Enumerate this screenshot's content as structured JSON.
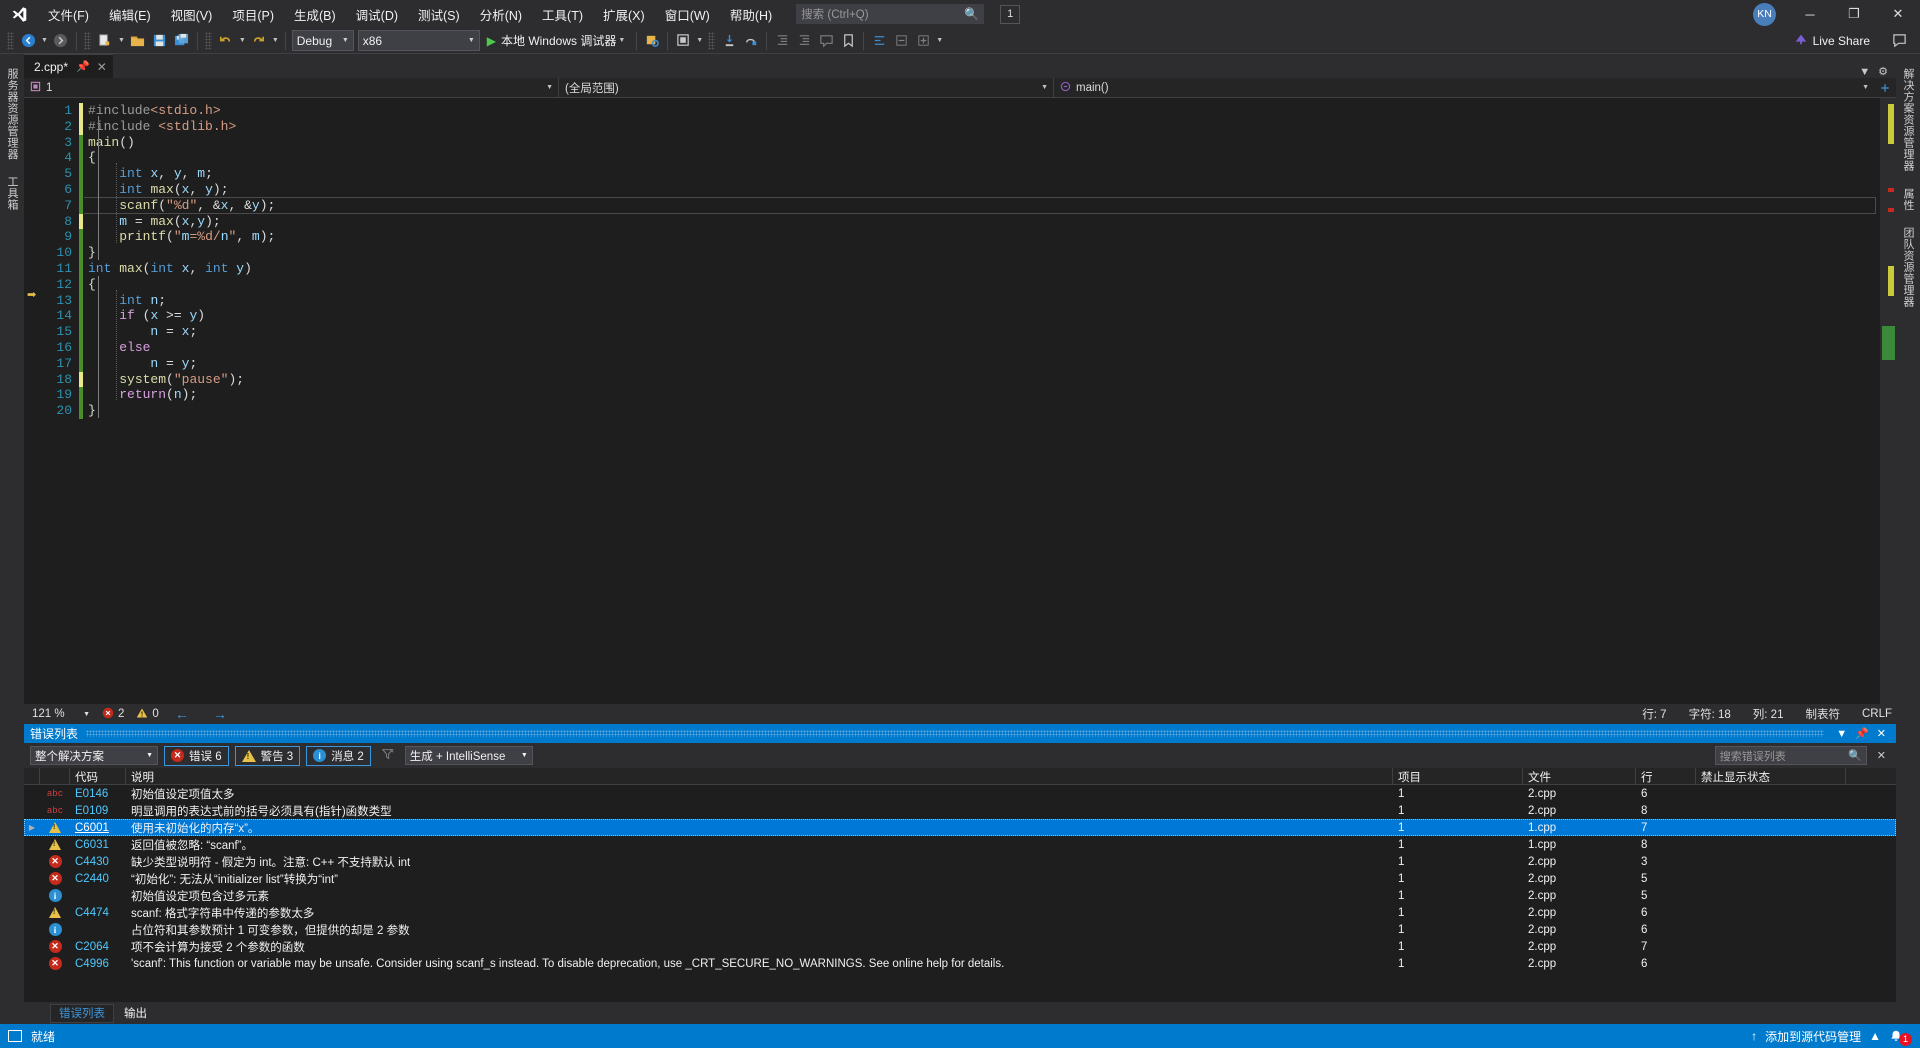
{
  "titlebar": {
    "logo_icon": "visual-studio-logo",
    "menus": [
      "文件(F)",
      "编辑(E)",
      "视图(V)",
      "项目(P)",
      "生成(B)",
      "调试(D)",
      "测试(S)",
      "分析(N)",
      "工具(T)",
      "扩展(X)",
      "窗口(W)",
      "帮助(H)"
    ],
    "search_placeholder": "搜索 (Ctrl+Q)",
    "search_icon": "search-icon",
    "notification_count": "1",
    "avatar_initials": "KN",
    "minimize_icon": "─",
    "maximize_icon": "❐",
    "close_icon": "✕"
  },
  "toolbar": {
    "back_icon": "navigate-back-icon",
    "forward_icon": "navigate-forward-icon",
    "new_item_icon": "new-item-icon",
    "open_icon": "open-file-icon",
    "save_icon": "save-icon",
    "save_all_icon": "save-all-icon",
    "undo_icon": "undo-icon",
    "redo_icon": "redo-icon",
    "config_value": "Debug",
    "platform_value": "x86",
    "run_label": "本地 Windows 调试器",
    "play_icon": "play-icon",
    "live_share_label": "Live Share",
    "live_share_icon": "live-share-icon",
    "feedback_icon": "feedback-icon"
  },
  "left_rail": {
    "tabs": [
      "服务器资源管理器",
      "工具箱"
    ]
  },
  "right_rail": {
    "tabs": [
      "解决方案资源管理器",
      "属性",
      "团队资源管理器"
    ]
  },
  "editor": {
    "tab_title": "2.cpp*",
    "pin_icon": "pin-icon",
    "close_icon": "✕",
    "nav_scope_icon": "project-icon",
    "nav_project": "1",
    "nav_scope": "(全局范围)",
    "nav_member_icon": "method-icon",
    "nav_member": "main()",
    "lines": [
      {
        "n": "1",
        "html": "#include<stdio.h>",
        "fold": "minus",
        "change": "mod"
      },
      {
        "n": "2",
        "html": "#include <stdlib.h>",
        "change": "mod"
      },
      {
        "n": "3",
        "html": "main()",
        "fold": "minus",
        "change": "save"
      },
      {
        "n": "4",
        "html": "{",
        "change": "save"
      },
      {
        "n": "5",
        "html": "    int x, y, m;",
        "change": "save"
      },
      {
        "n": "6",
        "html": "    int max(x, y);",
        "change": "save"
      },
      {
        "n": "7",
        "html": "    scanf(\"%d\", &x, &y);",
        "change": "save",
        "current": true
      },
      {
        "n": "8",
        "html": "    m = max(x,y);",
        "change": "mod"
      },
      {
        "n": "9",
        "html": "    printf(\"m=%d/n\", m);",
        "change": "save"
      },
      {
        "n": "10",
        "html": "}",
        "change": "save"
      },
      {
        "n": "11",
        "html": "int max(int x, int y)",
        "fold": "minus",
        "change": "save"
      },
      {
        "n": "12",
        "html": "{",
        "change": "save"
      },
      {
        "n": "13",
        "html": "    int n;",
        "change": "save"
      },
      {
        "n": "14",
        "html": "    if (x >= y)",
        "change": "save"
      },
      {
        "n": "15",
        "html": "        n = x;",
        "change": "save"
      },
      {
        "n": "16",
        "html": "    else",
        "change": "save"
      },
      {
        "n": "17",
        "html": "        n = y;",
        "change": "save"
      },
      {
        "n": "18",
        "html": "    system(\"pause\");",
        "change": "mod"
      },
      {
        "n": "19",
        "html": "    return(n);",
        "change": "save"
      },
      {
        "n": "20",
        "html": "}",
        "change": "save"
      }
    ]
  },
  "editor_status": {
    "zoom": "121 %",
    "error_count": "2",
    "warning_count": "0",
    "error_icon": "error-circle-icon",
    "warning_icon": "warning-triangle-icon",
    "prev_icon": "←",
    "next_icon": "→",
    "row_label": "行: 7",
    "char_label": "字符: 18",
    "col_label": "列: 21",
    "tab_label": "制表符",
    "eol_label": "CRLF"
  },
  "error_list": {
    "title": "错误列表",
    "dropdown_icon": "chevron-down-icon",
    "pin_icon": "pin-icon",
    "close_icon": "✕",
    "scope_value": "整个解决方案",
    "errors_label": "错误 6",
    "warnings_label": "警告 3",
    "messages_label": "消息 2",
    "filter_icon": "clear-filter-icon",
    "build_filter_value": "生成 + IntelliSense",
    "search_placeholder": "搜索错误列表",
    "search_icon": "search-icon",
    "search_clear_icon": "✕",
    "columns": [
      "",
      "",
      "代码",
      "说明",
      "项目",
      "文件",
      "行",
      "禁止显示状态",
      ""
    ],
    "rows": [
      {
        "icon": "abc",
        "code": "E0146",
        "desc": "初始值设定项值太多",
        "proj": "1",
        "file": "2.cpp",
        "line": "6",
        "sup": "",
        "expand": false,
        "selected": false
      },
      {
        "icon": "abc",
        "code": "E0109",
        "desc": "明显调用的表达式前的括号必须具有(指针)函数类型",
        "proj": "1",
        "file": "2.cpp",
        "line": "8",
        "sup": "",
        "expand": false,
        "selected": false
      },
      {
        "icon": "warn",
        "code": "C6001",
        "desc": "使用未初始化的内存“x”。",
        "proj": "1",
        "file": "1.cpp",
        "line": "7",
        "sup": "",
        "expand": true,
        "selected": true
      },
      {
        "icon": "warn",
        "code": "C6031",
        "desc": "返回值被忽略: “scanf”。",
        "proj": "1",
        "file": "1.cpp",
        "line": "8",
        "sup": "",
        "expand": false,
        "selected": false
      },
      {
        "icon": "err",
        "code": "C4430",
        "desc": "缺少类型说明符 - 假定为 int。注意: C++ 不支持默认 int",
        "proj": "1",
        "file": "2.cpp",
        "line": "3",
        "sup": "",
        "expand": false,
        "selected": false
      },
      {
        "icon": "err",
        "code": "C2440",
        "desc": "“初始化”: 无法从“initializer list”转换为“int”",
        "proj": "1",
        "file": "2.cpp",
        "line": "5",
        "sup": "",
        "expand": false,
        "selected": false
      },
      {
        "icon": "info",
        "code": "",
        "desc": "初始值设定项包含过多元素",
        "proj": "1",
        "file": "2.cpp",
        "line": "5",
        "sup": "",
        "expand": false,
        "selected": false
      },
      {
        "icon": "warn",
        "code": "C4474",
        "desc": "scanf: 格式字符串中传递的参数太多",
        "proj": "1",
        "file": "2.cpp",
        "line": "6",
        "sup": "",
        "expand": false,
        "selected": false
      },
      {
        "icon": "info",
        "code": "",
        "desc": "占位符和其参数预计 1 可变参数，但提供的却是 2 参数",
        "proj": "1",
        "file": "2.cpp",
        "line": "6",
        "sup": "",
        "expand": false,
        "selected": false
      },
      {
        "icon": "err",
        "code": "C2064",
        "desc": "项不会计算为接受 2 个参数的函数",
        "proj": "1",
        "file": "2.cpp",
        "line": "7",
        "sup": "",
        "expand": false,
        "selected": false
      },
      {
        "icon": "err",
        "code": "C4996",
        "desc": "'scanf': This function or variable may be unsafe. Consider using scanf_s instead. To disable deprecation, use _CRT_SECURE_NO_WARNINGS. See online help for details.",
        "proj": "1",
        "file": "2.cpp",
        "line": "6",
        "sup": "",
        "expand": false,
        "selected": false
      }
    ]
  },
  "bottom_tabs": [
    {
      "label": "错误列表",
      "active": true
    },
    {
      "label": "输出",
      "active": false
    }
  ],
  "statusbar": {
    "ready_label": "就绪",
    "ready_icon": "ready-icon",
    "source_control_label": "添加到源代码管理",
    "up_arrow_icon": "↑",
    "chevron_up_icon": "▲",
    "bell_icon": "bell-icon",
    "bell_count": "1"
  },
  "colors": {
    "accent": "#007acc",
    "selection": "#0078d7",
    "editor_bg": "#1e1e1e",
    "chrome_bg": "#2d2d30",
    "error_red": "#c42b1c",
    "warn_yellow": "#e8c14a",
    "info_blue": "#2b8fd4"
  }
}
